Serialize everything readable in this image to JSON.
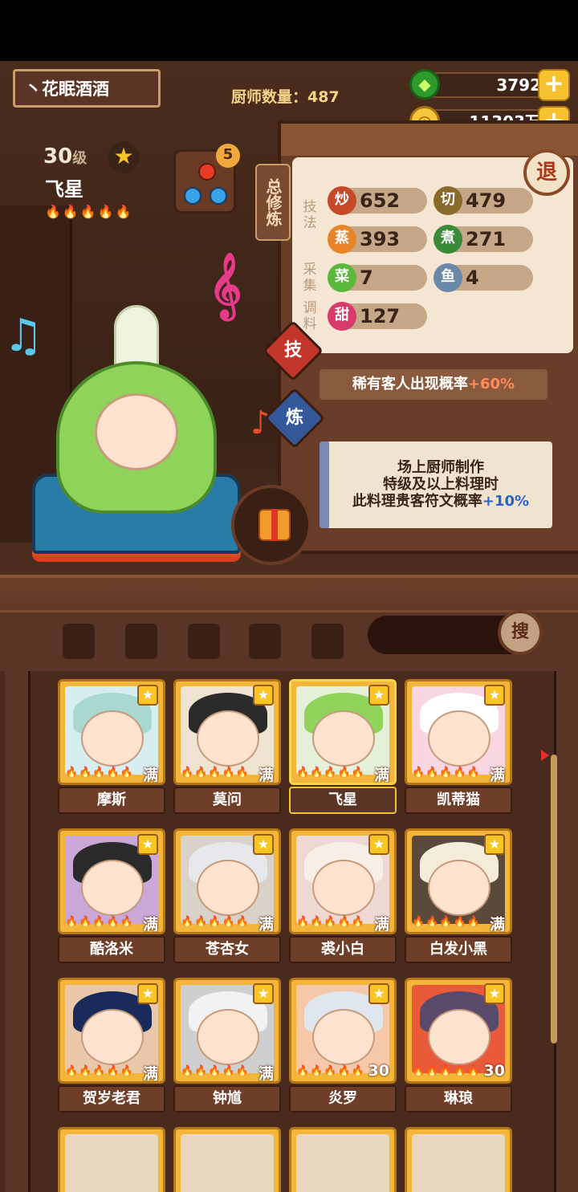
{
  "header": {
    "restaurant_name": "丶花眠酒酒",
    "chef_count_label": "厨师数量：487"
  },
  "currency": {
    "jade": "3792",
    "gold": "11303万",
    "plus": "+"
  },
  "chef": {
    "level": "30",
    "level_unit": "级",
    "name": "飞星",
    "flames": "🔥🔥🔥🔥🔥",
    "equip_count": "5"
  },
  "panel": {
    "total_training_tab": "总修炼",
    "retreat_label": "退",
    "section_technique": "技法",
    "section_gather": "采集",
    "section_seasoning": "调料",
    "stats": [
      {
        "icon": "炒",
        "value": "652",
        "color": "#c6492a"
      },
      {
        "icon": "切",
        "value": "479",
        "color": "#8a6a2a"
      },
      {
        "icon": "蒸",
        "value": "393",
        "color": "#e8842a"
      },
      {
        "icon": "煮",
        "value": "271",
        "color": "#3a8a3a"
      },
      {
        "icon": "菜",
        "value": "7",
        "color": "#5ab83a"
      },
      {
        "icon": "鱼",
        "value": "4",
        "color": "#6a88a8"
      },
      {
        "icon": "甜",
        "value": "127",
        "color": "#d83a6a"
      }
    ],
    "skill_button": "技",
    "train_button": "炼",
    "rare_guest_text": "稀有客人出现概率",
    "rare_guest_bonus": "+60%",
    "rune_line1": "场上厨师制作",
    "rune_line2": "特级及以上料理时",
    "rune_line3": "此料理贵客符文概率",
    "rune_bonus": "+10%"
  },
  "toolbar": {
    "search_button": "搜"
  },
  "chef_list": [
    {
      "name": "摩斯",
      "tag": "满",
      "flames": "🔥🔥🔥🔥🔥",
      "hair": "#a8d8d0",
      "bg": "#d7eef0"
    },
    {
      "name": "莫问",
      "tag": "满",
      "flames": "🔥🔥🔥🔥🔥",
      "hair": "#2a2a2a",
      "bg": "#efe4d2"
    },
    {
      "name": "飞星",
      "tag": "满",
      "flames": "🔥🔥🔥🔥🔥",
      "hair": "#8fd35a",
      "bg": "#e4f0d8"
    },
    {
      "name": "凯蒂猫",
      "tag": "满",
      "flames": "🔥🔥🔥🔥🔥",
      "hair": "#ffffff",
      "bg": "#f8d6e2"
    },
    {
      "name": "酷洛米",
      "tag": "满",
      "flames": "🔥🔥🔥🔥🔥",
      "hair": "#2a2a2a",
      "bg": "#c9a8d8"
    },
    {
      "name": "苍杏女",
      "tag": "满",
      "flames": "🔥🔥🔥🔥🔥",
      "hair": "#e6e8ec",
      "bg": "#d8d2c8"
    },
    {
      "name": "裘小白",
      "tag": "满",
      "flames": "🔥🔥🔥🔥🔥",
      "hair": "#f7efe6",
      "bg": "#eed8d2"
    },
    {
      "name": "白发小黑",
      "tag": "满",
      "flames": "🔥🔥🔥🔥🔥",
      "hair": "#f2ecd8",
      "bg": "#5a4a3a"
    },
    {
      "name": "贺岁老君",
      "tag": "满",
      "flames": "🔥🔥🔥🔥🔥",
      "hair": "#1a2a5a",
      "bg": "#e8c8a8"
    },
    {
      "name": "钟馗",
      "tag": "满",
      "flames": "🔥🔥🔥🔥🔥",
      "hair": "#f2f2f2",
      "bg": "#cfcfcf"
    },
    {
      "name": "炎罗",
      "tag": "30",
      "flames": "🔥🔥🔥🔥🔥",
      "hair": "#dfe6ee",
      "bg": "#f4c8a8"
    },
    {
      "name": "琳琅",
      "tag": "30",
      "flames": "🔥🔥🔥🔥🔥",
      "hair": "#5a4a6a",
      "bg": "#e85a3a"
    }
  ]
}
